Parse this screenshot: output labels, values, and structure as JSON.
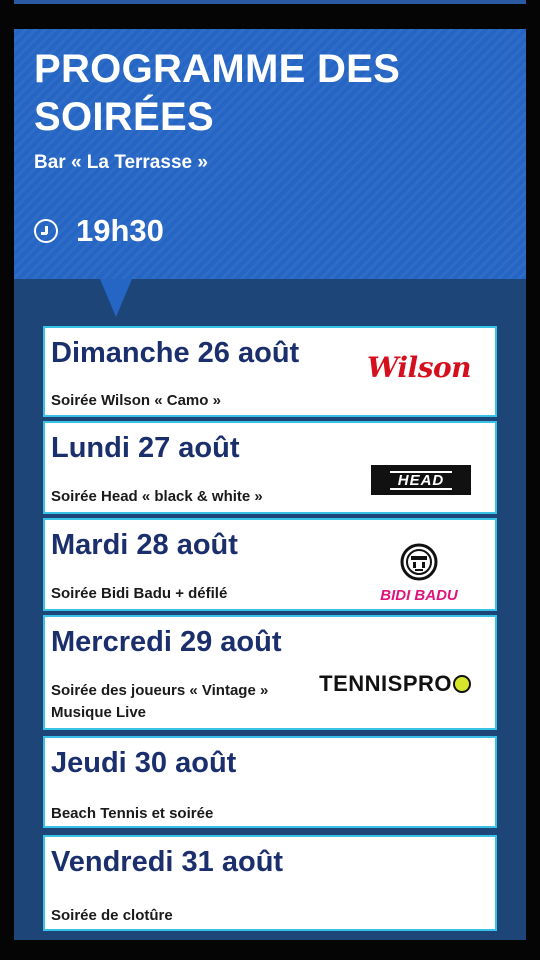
{
  "header": {
    "title": "PROGRAMME DES SOIRÉES",
    "subtitle": "Bar « La Terrasse »",
    "time": "19h30",
    "time_icon": "clock-icon"
  },
  "events": [
    {
      "date": "Dimanche 26 août",
      "description": "Soirée Wilson « Camo »",
      "logo_text": "Wilson",
      "logo": "wilson-logo"
    },
    {
      "date": "Lundi 27 août",
      "description": "Soirée Head « black & white »",
      "logo_text": "HEAD",
      "logo": "head-logo"
    },
    {
      "date": "Mardi 28 août",
      "description": "Soirée Bidi Badu + défilé",
      "logo_text": "BIDI BADU",
      "logo": "bidi-badu-logo"
    },
    {
      "date": "Mercredi 29 août",
      "description": "Soirée des joueurs « Vintage »",
      "description_2": "Musique Live",
      "logo_text": "TENNISPRO",
      "logo": "tennispro-logo"
    },
    {
      "date": "Jeudi 30 août",
      "description": "Beach Tennis et soirée"
    },
    {
      "date": "Vendredi 31 août",
      "description": "Soirée de clotûre"
    }
  ],
  "colors": {
    "header_blue": "#2565c4",
    "card_navy": "#1d4577",
    "event_border": "#38c2e6",
    "date_text": "#1b2f6d",
    "wilson_red": "#d4101e",
    "bidi_pink": "#e0157a"
  }
}
